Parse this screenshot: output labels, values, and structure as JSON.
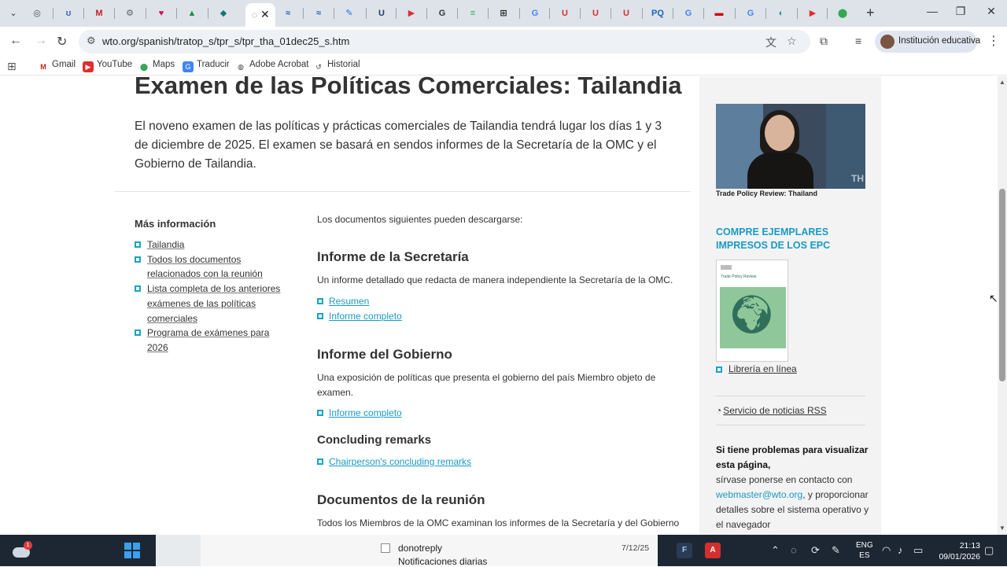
{
  "browser": {
    "url": "wto.org/spanish/tratop_s/tpr_s/tpr_tha_01dec25_s.htm",
    "profile_label": "Institución educativa",
    "tabs": [
      {
        "icon": "chrome-icon",
        "color": "#4a4a4a",
        "glyph": "◎"
      },
      {
        "icon": "bing-icon",
        "color": "#3b6cc7",
        "glyph": "ʊ"
      },
      {
        "icon": "gmail-icon",
        "color": "#c5221f",
        "glyph": "M"
      },
      {
        "icon": "settings-icon",
        "color": "#5f6368",
        "glyph": "⚙"
      },
      {
        "icon": "heart-icon",
        "color": "#c2185b",
        "glyph": "♥"
      },
      {
        "icon": "drive-icon",
        "color": "#1e8e3e",
        "glyph": "▲"
      },
      {
        "icon": "extension-icon",
        "color": "#0f7b75",
        "glyph": "◆"
      },
      {
        "icon": "wto-icon",
        "color": "#1a5fb4",
        "glyph": "≈"
      },
      {
        "icon": "wto-icon-2",
        "color": "#1a5fb4",
        "glyph": "≈"
      },
      {
        "icon": "wand-icon",
        "color": "#1a73e8",
        "glyph": "✎"
      },
      {
        "icon": "u-icon",
        "color": "#1d3c6e",
        "glyph": "U"
      },
      {
        "icon": "youtube-icon",
        "color": "#e32d2d",
        "glyph": "▶"
      },
      {
        "icon": "google-c-icon",
        "color": "#333333",
        "glyph": "G"
      },
      {
        "icon": "spotify-icon",
        "color": "#1db954",
        "glyph": "≡"
      },
      {
        "icon": "ai-icon",
        "color": "#222222",
        "glyph": "⊞"
      },
      {
        "icon": "google-icon",
        "color": "#4285f4",
        "glyph": "G"
      },
      {
        "icon": "uk-icon",
        "color": "#d32f2f",
        "glyph": "U"
      },
      {
        "icon": "uk-icon-2",
        "color": "#d32f2f",
        "glyph": "U"
      },
      {
        "icon": "uk-icon-3",
        "color": "#d32f2f",
        "glyph": "U"
      },
      {
        "icon": "pq-icon",
        "color": "#1565c0",
        "glyph": "PQ"
      },
      {
        "icon": "google-icon-2",
        "color": "#4285f4",
        "glyph": "G"
      },
      {
        "icon": "cnn-icon",
        "color": "#cc0000",
        "glyph": "▬"
      },
      {
        "icon": "google-icon-3",
        "color": "#4285f4",
        "glyph": "G"
      },
      {
        "icon": "edge-icon",
        "color": "#0f9d8f",
        "glyph": "◐"
      },
      {
        "icon": "youtube-icon-2",
        "color": "#e32d2d",
        "glyph": "▶"
      },
      {
        "icon": "maps-icon",
        "color": "#34a853",
        "glyph": "⬤"
      }
    ]
  },
  "bookmarks": [
    {
      "label": "Gmail",
      "icon": "gmail-icon"
    },
    {
      "label": "YouTube",
      "icon": "youtube-icon"
    },
    {
      "label": "Maps",
      "icon": "maps-icon"
    },
    {
      "label": "Traducir",
      "icon": "translate-icon"
    },
    {
      "label": "Adobe Acrobat",
      "icon": "acrobat-icon"
    },
    {
      "label": "Historial",
      "icon": "history-icon"
    }
  ],
  "page": {
    "title": "Examen de las Políticas Comerciales: Tailandia",
    "intro": "El noveno examen de las políticas y prácticas comerciales de Tailandia tendrá lugar los días 1 y 3 de diciembre de 2025. El examen se basará en sendos informes de la Secretaría de la OMC y el Gobierno de Tailandia.",
    "more_info": {
      "title": "Más información",
      "links": [
        "Tailandia",
        "Todos los documentos relacionados con la reunión",
        "Lista completa de los anteriores exámenes de las políticas comerciales",
        "Programa de exámenes para 2026"
      ]
    },
    "main": {
      "downloads_intro": "Los documentos siguientes pueden descargarse:",
      "secretariat": {
        "heading": "Informe de la Secretaría",
        "text": "Un informe detallado que redacta de manera independiente la Secretaría de la OMC.",
        "links": [
          "Resumen",
          "Informe completo"
        ]
      },
      "government": {
        "heading": "Informe del Gobierno",
        "text": "Una exposición de políticas que presenta el gobierno del país Miembro objeto de examen.",
        "links": [
          "Informe completo"
        ]
      },
      "concluding": {
        "heading": "Concluding remarks",
        "links": [
          "Chairperson's concluding remarks"
        ]
      },
      "meeting": {
        "heading": "Documentos de la reunión",
        "text": "Todos los Miembros de la OMC examinan los informes de la Secretaría y del Gobierno"
      }
    },
    "sidebar": {
      "video_caption": "Trade Policy Review: Thailand",
      "video_overlay": "TH",
      "buy_heading": "COMPRE EJEMPLARES IMPRESOS DE LOS EPC",
      "book_cover_title": "Trade Policy Review",
      "bookstore_link": "Librería en línea",
      "rss_link": "Servicio de noticias RSS",
      "problems_title": "Si tiene problemas para visualizar esta página,",
      "problems_text_1": "sírvase ponerse en contacto con",
      "problems_email": "webmaster@wto.org",
      "problems_text_2": ", y proporcionar detalles sobre el sistema operativo y el navegador"
    }
  },
  "taskbar": {
    "weather_badge": "1",
    "notification": {
      "from": "donotreply",
      "subject": "Notificaciones diarias",
      "date": "7/12/25"
    },
    "lang_1": "ENG",
    "lang_2": "ES",
    "time": "21:13",
    "date": "09/01/2026"
  }
}
